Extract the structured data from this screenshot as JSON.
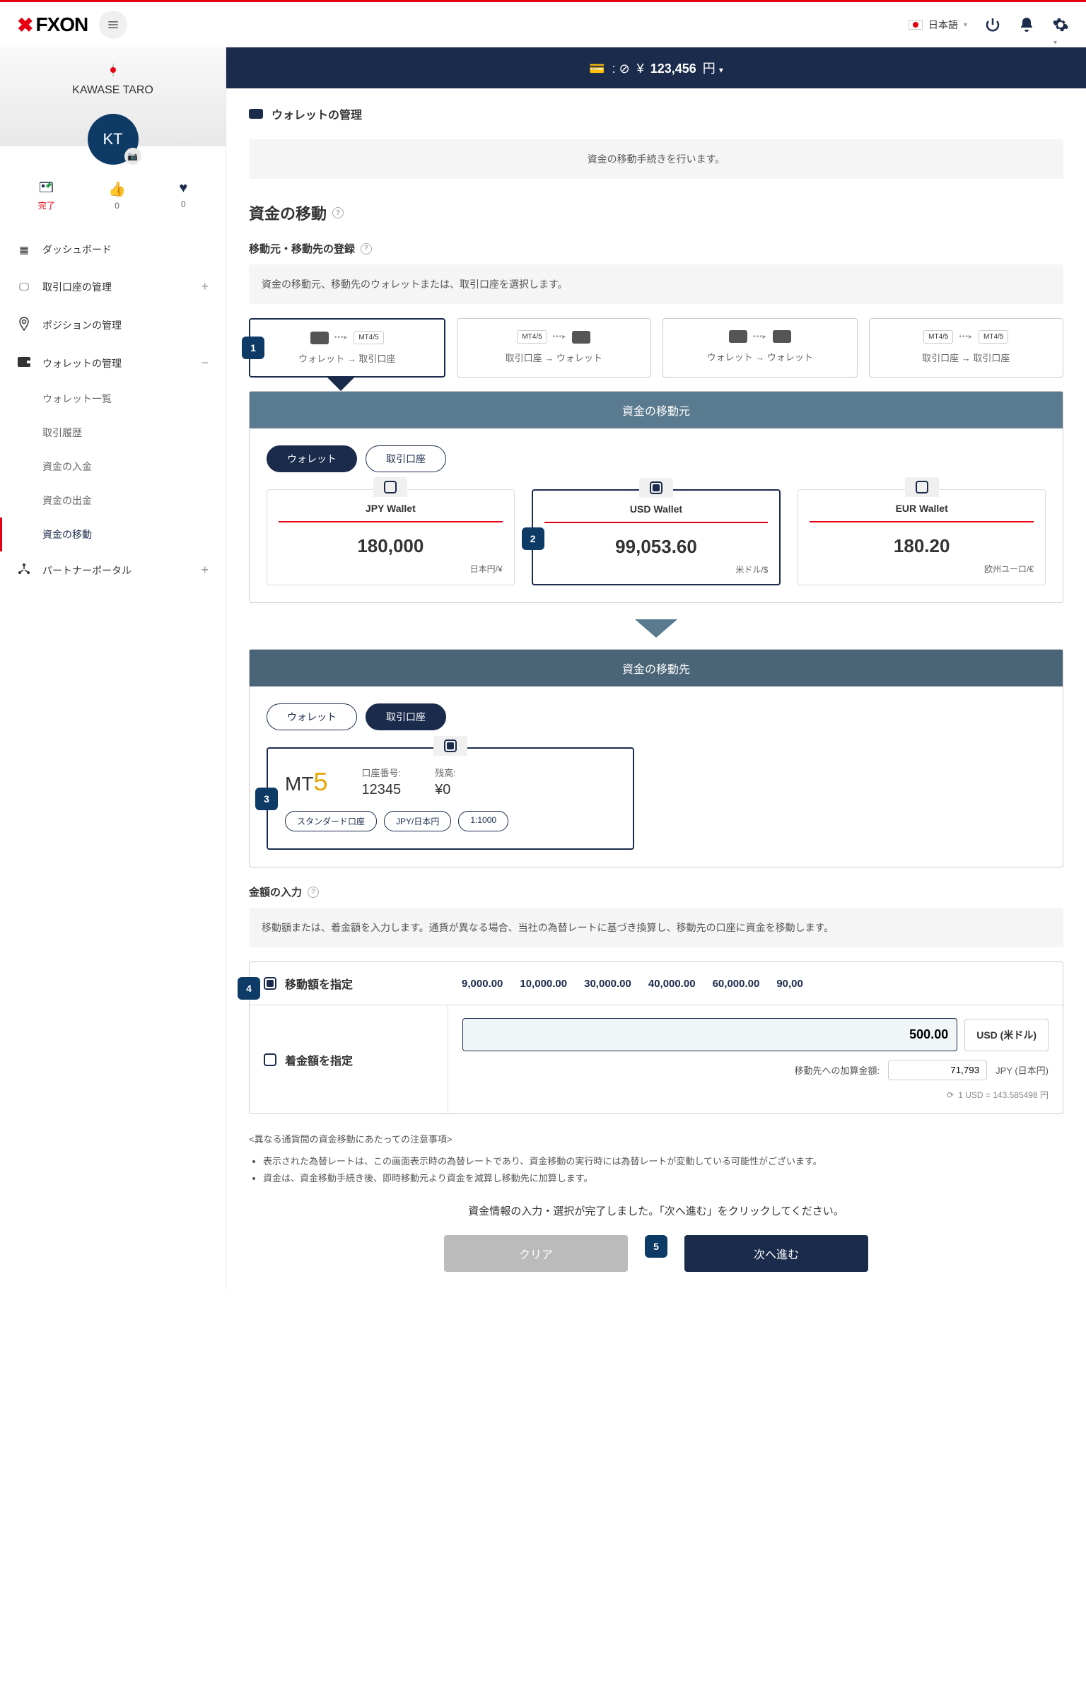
{
  "header": {
    "logo_text": "FXON",
    "language": "日本語"
  },
  "profile": {
    "name": "KAWASE TARO",
    "initials": "KT"
  },
  "stats": {
    "done_label": "完了",
    "like_count": "0",
    "fav_count": "0"
  },
  "nav": {
    "dashboard": "ダッシュボード",
    "accounts": "取引口座の管理",
    "positions": "ポジションの管理",
    "wallet": "ウォレットの管理",
    "partner": "パートナーポータル",
    "wallet_sub": {
      "list": "ウォレット一覧",
      "history": "取引履歴",
      "deposit": "資金の入金",
      "withdraw": "資金の出金",
      "transfer": "資金の移動"
    }
  },
  "balance": {
    "symbol": "¥",
    "amount": "123,456",
    "unit": "円"
  },
  "page": {
    "title": "ウォレットの管理",
    "intro": "資金の移動手続きを行います。",
    "section": "資金の移動",
    "reg_title": "移動元・移動先の登録",
    "reg_desc": "資金の移動元、移動先のウォレットまたは、取引口座を選択します。"
  },
  "tabs": {
    "t1": "ウォレット → 取引口座",
    "t2": "取引口座 → ウォレット",
    "t3": "ウォレット → ウォレット",
    "t4": "取引口座 → 取引口座",
    "mt_label": "MT4/5"
  },
  "source": {
    "header": "資金の移動元",
    "pill_wallet": "ウォレット",
    "pill_account": "取引口座",
    "wallets": [
      {
        "name": "JPY Wallet",
        "amount": "180,000",
        "currency": "日本円/¥"
      },
      {
        "name": "USD Wallet",
        "amount": "99,053.60",
        "currency": "米ドル/$"
      },
      {
        "name": "EUR Wallet",
        "amount": "180.20",
        "currency": "欧州ユーロ/€"
      }
    ]
  },
  "dest": {
    "header": "資金の移動先",
    "pill_wallet": "ウォレット",
    "pill_account": "取引口座",
    "mt5": "MT",
    "acct_label": "口座番号:",
    "acct_value": "12345",
    "bal_label": "残高:",
    "bal_value": "¥0",
    "chips": [
      "スタンダード口座",
      "JPY/日本円",
      "1:1000"
    ]
  },
  "amount": {
    "title": "金額の入力",
    "desc": "移動額または、着金額を入力します。通貨が異なる場合、当社の為替レートに基づき換算し、移動先の口座に資金を移動します。",
    "opt1": "移動額を指定",
    "opt2": "着金額を指定",
    "presets": [
      "9,000.00",
      "10,000.00",
      "30,000.00",
      "40,000.00",
      "60,000.00",
      "90,00"
    ],
    "input_value": "500.00",
    "currency_label": "USD (米ドル)",
    "calc_label": "移動先への加算金額:",
    "calc_value": "71,793",
    "calc_unit": "JPY (日本円)",
    "rate": "1 USD = 143.585498 円"
  },
  "notes": {
    "title": "<異なる通貨間の資金移動にあたっての注意事項>",
    "n1": "表示された為替レートは、この画面表示時の為替レートであり、資金移動の実行時には為替レートが変動している可能性がございます。",
    "n2": "資金は、資金移動手続き後、即時移動元より資金を減算し移動先に加算します。"
  },
  "final": "資金情報の入力・選択が完了しました。「次へ進む」をクリックしてください。",
  "buttons": {
    "clear": "クリア",
    "next": "次へ進む"
  }
}
